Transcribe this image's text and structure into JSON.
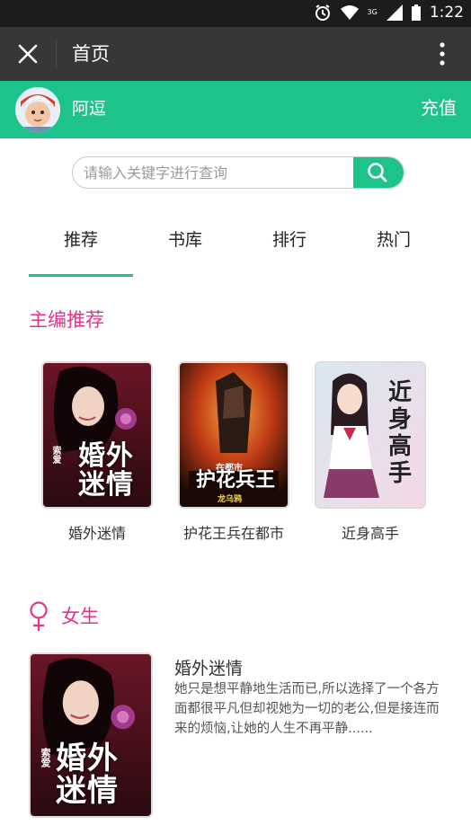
{
  "status_bar": {
    "time": "1:22",
    "network_label": "3G"
  },
  "app_bar": {
    "title": "首页"
  },
  "user": {
    "name": "阿逗",
    "recharge_label": "充值"
  },
  "search": {
    "placeholder": "请输入关键字进行查询"
  },
  "tabs": [
    {
      "label": "推荐",
      "active": true
    },
    {
      "label": "书库",
      "active": false
    },
    {
      "label": "排行",
      "active": false
    },
    {
      "label": "热门",
      "active": false
    }
  ],
  "editor_picks": {
    "title": "主编推荐",
    "books": [
      {
        "title": "婚外迷情",
        "cover_text": "婚外迷情",
        "cover_tag": "索爱"
      },
      {
        "title": "护花王兵在都市",
        "cover_text": "护花兵王",
        "cover_tag": "在都市",
        "cover_author": "龙乌鸦"
      },
      {
        "title": "近身高手",
        "cover_text": "近身高手"
      }
    ]
  },
  "female_section": {
    "title": "女生",
    "items": [
      {
        "title": "婚外迷情",
        "description": "她只是想平静地生活而已,所以选择了一个各方面都很平凡但却视她为一切的老公,但是接连而来的烦恼,让她的人生不再平静......",
        "cover_text": "婚外迷情",
        "cover_tag": "索爱"
      }
    ]
  },
  "colors": {
    "accent_green": "#1ec28b",
    "section_pink": "#e5338a",
    "app_bar": "#373737",
    "status_bar": "#1c1c1e"
  }
}
